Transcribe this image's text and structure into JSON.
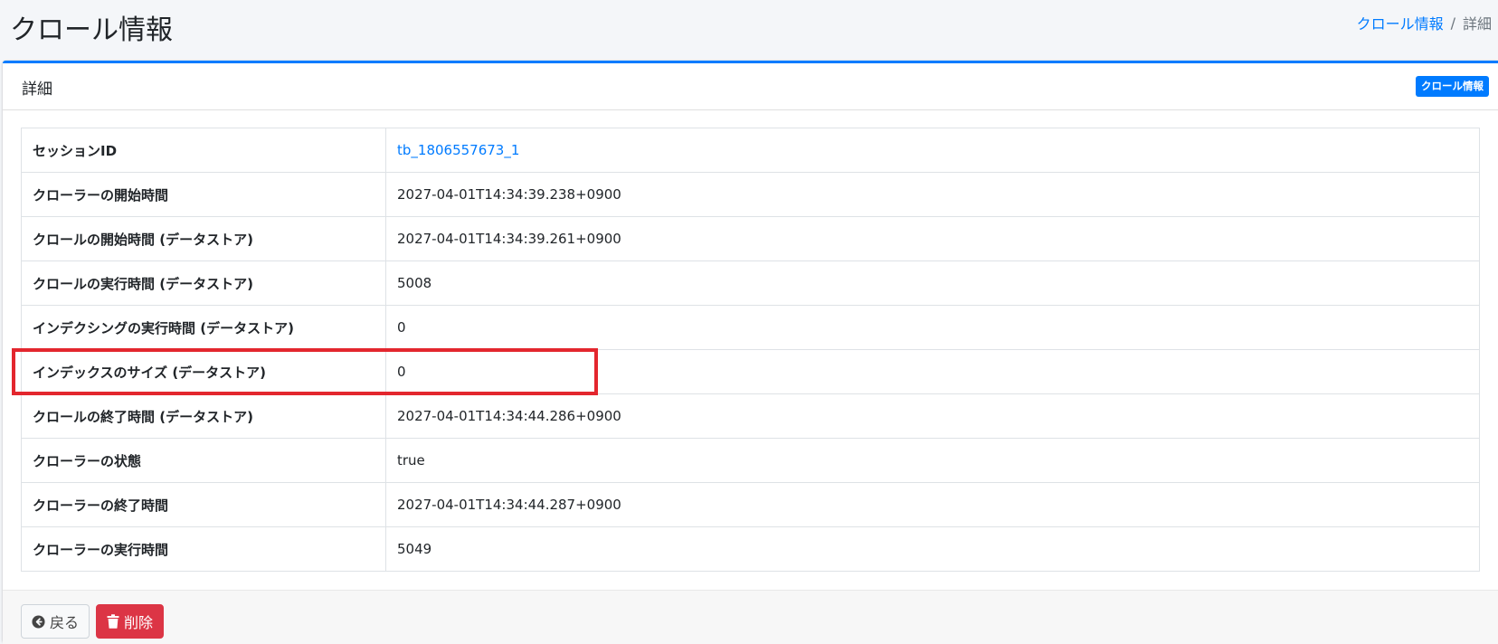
{
  "header": {
    "title": "クロール情報",
    "breadcrumb": [
      {
        "label": "クロール情報"
      },
      {
        "label": "詳細"
      }
    ]
  },
  "card": {
    "title": "詳細",
    "tool_button": "クロール情報"
  },
  "details": [
    {
      "label": "セッションID",
      "value": "tb_1806557673_1"
    },
    {
      "label": "クローラーの開始時間",
      "value": "2027-04-01T14:34:39.238+0900"
    },
    {
      "label": "クロールの開始時間 (データストア)",
      "value": "2027-04-01T14:34:39.261+0900"
    },
    {
      "label": "クロールの実行時間 (データストア)",
      "value": "5008"
    },
    {
      "label": "インデクシングの実行時間 (データストア)",
      "value": "0"
    },
    {
      "label": "インデックスのサイズ (データストア)",
      "value": "0"
    },
    {
      "label": "クロールの終了時間 (データストア)",
      "value": "2027-04-01T14:34:44.286+0900"
    },
    {
      "label": "クローラーの状態",
      "value": "true"
    },
    {
      "label": "クローラーの終了時間",
      "value": "2027-04-01T14:34:44.287+0900"
    },
    {
      "label": "クローラーの実行時間",
      "value": "5049"
    }
  ],
  "footer": {
    "back_label": "戻る",
    "delete_label": "削除"
  },
  "colors": {
    "primary": "#007bff",
    "danger": "#dc3545",
    "highlight": "#e3262e"
  }
}
